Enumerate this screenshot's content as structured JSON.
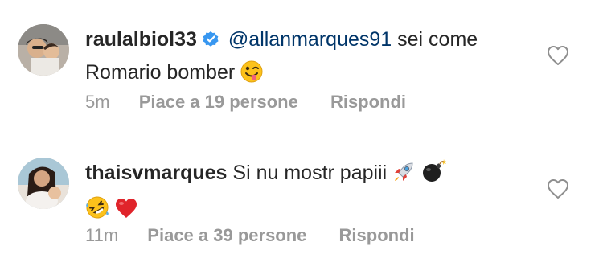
{
  "comments": [
    {
      "username": "raulalbiol33",
      "verified": true,
      "mention": "@allanmarques91",
      "text": "sei come Romario bomber",
      "emoji": [
        "winking-tongue-face"
      ],
      "time": "5m",
      "likes": "Piace a 19 persone",
      "reply": "Rispondi"
    },
    {
      "username": "thaisvmarques",
      "verified": false,
      "text": "Si nu mostr papiii",
      "emoji": [
        "rocket",
        "bomb",
        "rolling-laughing-face",
        "red-heart"
      ],
      "time": "11m",
      "likes": "Piace a 39 persone",
      "reply": "Rispondi"
    }
  ],
  "colors": {
    "username": "#262626",
    "mention": "#003569",
    "meta": "#999999",
    "verified": "#3897f0",
    "heart_outline": "#8e8e8e"
  }
}
